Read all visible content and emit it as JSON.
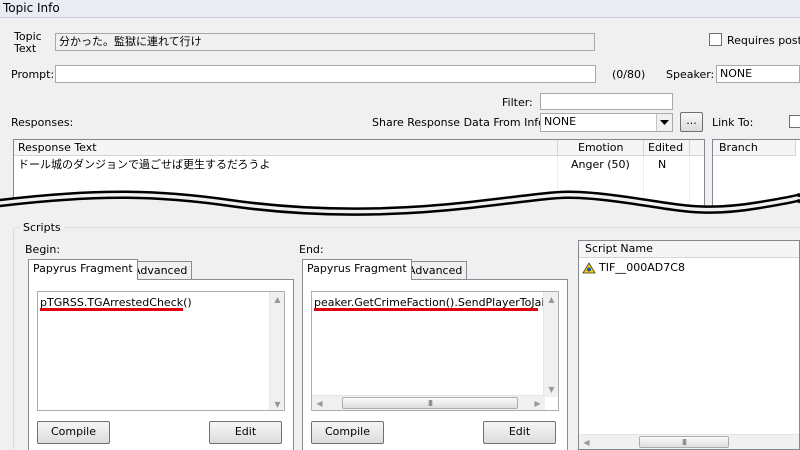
{
  "window": {
    "title": "Topic Info"
  },
  "topic": {
    "label_line1": "Topic",
    "label_line2": "Text",
    "value": "分かった。監獄に連れて行け"
  },
  "requires": {
    "label": "Requires post-p"
  },
  "prompt": {
    "label": "Prompt:",
    "value": "",
    "counter": "(0/80)"
  },
  "speaker": {
    "label": "Speaker:",
    "value": "NONE"
  },
  "filter": {
    "label": "Filter:",
    "value": ""
  },
  "responses": {
    "label": "Responses:",
    "share_label": "Share Response Data From Info:",
    "share_value": "NONE",
    "ellipsis_label": "...",
    "link_to_label": "Link To:",
    "columns": [
      "Response Text",
      "Emotion",
      "Edited"
    ],
    "rows": [
      {
        "text": "ドール城のダンジョンで過ごせば更生するだろうよ",
        "emotion": "Anger (50)",
        "edited": "N"
      }
    ],
    "branch_column": "Branch"
  },
  "scripts": {
    "group_label": "Scripts",
    "begin": {
      "label": "Begin:",
      "tabs": [
        "Papyrus Fragment",
        "Advanced"
      ],
      "code": "pTGRSS.TGArrestedCheck()",
      "compile_label": "Compile",
      "edit_label": "Edit"
    },
    "end": {
      "label": "End:",
      "tabs": [
        "Papyrus Fragment",
        "Advanced"
      ],
      "code": "peaker.GetCrimeFaction().SendPlayerToJail()",
      "compile_label": "Compile",
      "edit_label": "Edit"
    },
    "script_list": {
      "column": "Script Name",
      "items": [
        {
          "name": "TIF__000AD7C8",
          "icon": "script-icon"
        }
      ]
    }
  },
  "colors": {
    "highlight_underline": "#e0000f",
    "torn_edge": "#000000"
  }
}
